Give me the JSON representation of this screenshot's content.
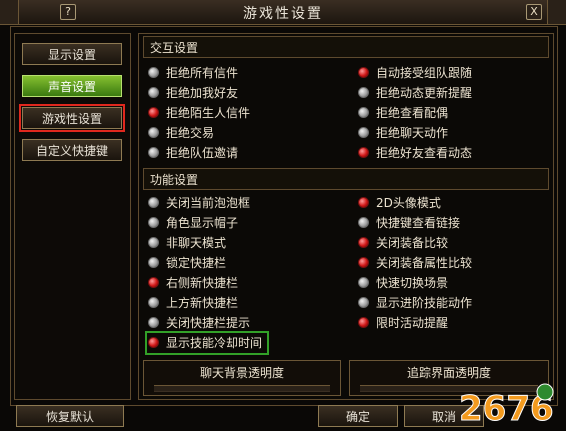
{
  "window": {
    "title": "游戏性设置",
    "help_label": "?",
    "close_label": "X"
  },
  "nav": {
    "items": [
      {
        "label": "显示设置",
        "state": "normal"
      },
      {
        "label": "声音设置",
        "state": "active"
      },
      {
        "label": "游戏性设置",
        "state": "selected"
      },
      {
        "label": "自定义快捷键",
        "state": "normal"
      }
    ]
  },
  "interaction": {
    "heading": "交互设置",
    "left": [
      {
        "label": "拒绝所有信件",
        "checked": false
      },
      {
        "label": "拒绝加我好友",
        "checked": false
      },
      {
        "label": "拒绝陌生人信件",
        "checked": true
      },
      {
        "label": "拒绝交易",
        "checked": false
      },
      {
        "label": "拒绝队伍邀请",
        "checked": false
      }
    ],
    "right": [
      {
        "label": "自动接受组队跟随",
        "checked": true
      },
      {
        "label": "拒绝动态更新提醒",
        "checked": false
      },
      {
        "label": "拒绝查看配偶",
        "checked": false
      },
      {
        "label": "拒绝聊天动作",
        "checked": false
      },
      {
        "label": "拒绝好友查看动态",
        "checked": true
      }
    ]
  },
  "function": {
    "heading": "功能设置",
    "left": [
      {
        "label": "关闭当前泡泡框",
        "checked": false
      },
      {
        "label": "角色显示帽子",
        "checked": false
      },
      {
        "label": "非聊天模式",
        "checked": false
      },
      {
        "label": "锁定快捷栏",
        "checked": false
      },
      {
        "label": "右侧新快捷栏",
        "checked": true
      },
      {
        "label": "上方新快捷栏",
        "checked": false
      },
      {
        "label": "关闭快捷栏提示",
        "checked": false
      },
      {
        "label": "显示技能冷却时间",
        "checked": true
      }
    ],
    "right": [
      {
        "label": "2D头像模式",
        "checked": true
      },
      {
        "label": "快捷键查看链接",
        "checked": false
      },
      {
        "label": "关闭装备比较",
        "checked": true
      },
      {
        "label": "关闭装备属性比较",
        "checked": true
      },
      {
        "label": "快速切换场景",
        "checked": false
      },
      {
        "label": "显示进阶技能动作",
        "checked": false
      },
      {
        "label": "限时活动提醒",
        "checked": true
      }
    ]
  },
  "sliders": {
    "chat_bg": "聊天背景透明度",
    "tracking": "追踪界面透明度"
  },
  "footer": {
    "restore": "恢复默认",
    "ok": "确定",
    "cancel": "取消"
  },
  "watermark": {
    "text": "2676"
  },
  "colors": {
    "active_nav": "#86c030",
    "checked_radio": "#d01818",
    "highlight_red": "#e0281e",
    "highlight_green": "#32a028",
    "border": "#5e4a2e"
  }
}
